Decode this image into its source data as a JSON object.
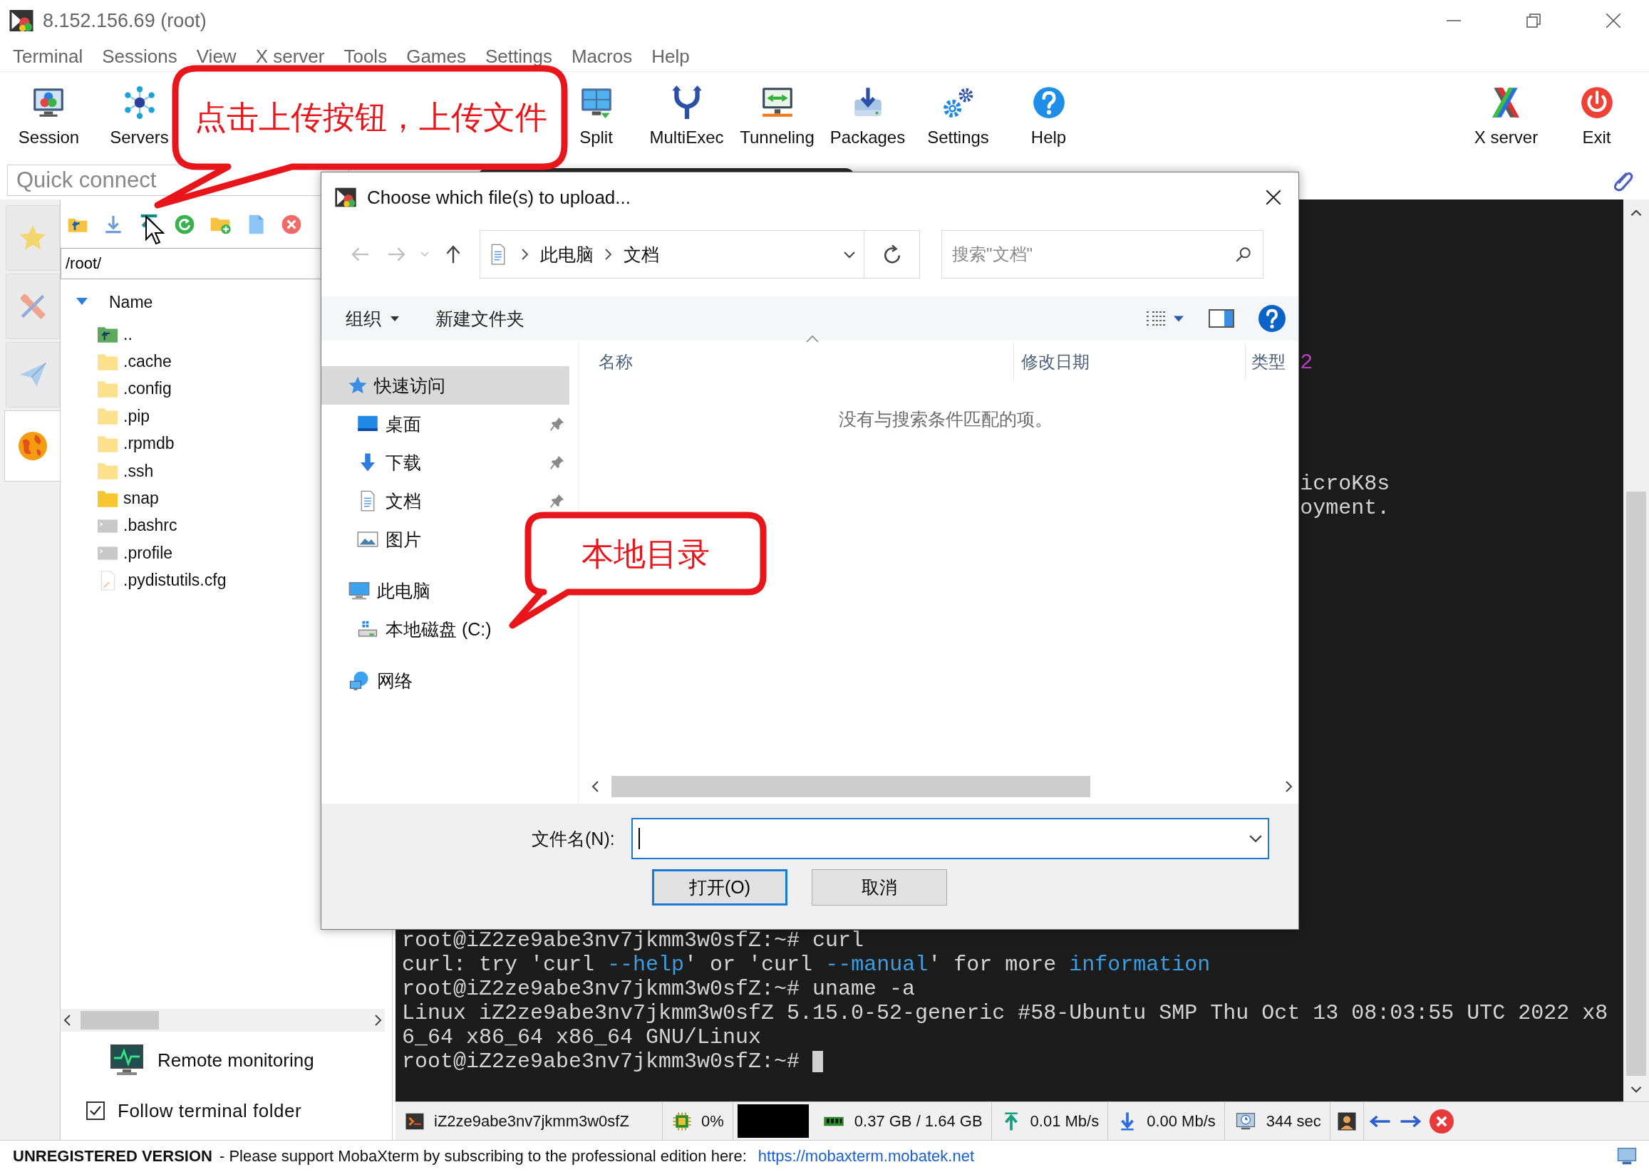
{
  "window": {
    "title": "8.152.156.69 (root)"
  },
  "menu": [
    "Terminal",
    "Sessions",
    "View",
    "X server",
    "Tools",
    "Games",
    "Settings",
    "Macros",
    "Help"
  ],
  "toolbar": {
    "buttons": [
      {
        "label": "Session",
        "kind": "session"
      },
      {
        "label": "Servers",
        "kind": "servers"
      },
      {
        "label": "Split",
        "kind": "split"
      },
      {
        "label": "MultiExec",
        "kind": "multiexec"
      },
      {
        "label": "Tunneling",
        "kind": "tunneling"
      },
      {
        "label": "Packages",
        "kind": "packages"
      },
      {
        "label": "Settings",
        "kind": "settings"
      },
      {
        "label": "Help",
        "kind": "help"
      }
    ],
    "right_buttons": [
      {
        "label": "X server",
        "kind": "xserver"
      },
      {
        "label": "Exit",
        "kind": "exit"
      }
    ]
  },
  "quick_connect": {
    "placeholder": "Quick connect"
  },
  "side_tabs": [
    {
      "kind": "star",
      "selected": false
    },
    {
      "kind": "tools",
      "selected": false
    },
    {
      "kind": "send",
      "selected": false
    },
    {
      "kind": "globe",
      "selected": true
    }
  ],
  "file_browser": {
    "tools": [
      {
        "kind": "up-folder"
      },
      {
        "kind": "download"
      },
      {
        "kind": "upload"
      },
      {
        "kind": "refresh"
      },
      {
        "kind": "new-folder"
      },
      {
        "kind": "new-file"
      },
      {
        "kind": "delete"
      }
    ],
    "path": "/root/",
    "column": "Name",
    "items": [
      {
        "name": "..",
        "kind": "parent",
        "hidden": false
      },
      {
        "name": ".cache",
        "kind": "folder",
        "hidden": true
      },
      {
        "name": ".config",
        "kind": "folder",
        "hidden": true
      },
      {
        "name": ".pip",
        "kind": "folder",
        "hidden": true
      },
      {
        "name": ".rpmdb",
        "kind": "folder",
        "hidden": true
      },
      {
        "name": ".ssh",
        "kind": "folder",
        "hidden": true
      },
      {
        "name": "snap",
        "kind": "folder",
        "hidden": false
      },
      {
        "name": ".bashrc",
        "kind": "terminal-file",
        "hidden": true
      },
      {
        "name": ".profile",
        "kind": "terminal-file",
        "hidden": true
      },
      {
        "name": ".pydistutils.cfg",
        "kind": "text-file",
        "hidden": true
      }
    ],
    "remote_monitoring": "Remote monitoring",
    "follow_terminal_folder": {
      "label": "Follow terminal folder",
      "checked": true
    }
  },
  "terminal": {
    "fragments": [
      {
        "text": "2",
        "color": "#c040c8"
      },
      {
        "text": "icroK8s",
        "color": "#d4d4d4"
      },
      {
        "text": "oyment.",
        "color": "#d4d4d4"
      }
    ],
    "lines": [
      {
        "cursor": false,
        "segments": [
          {
            "text": "root@iZ2ze9abe3nv7jkmm3w0sfZ:~# curl",
            "color": "#d4d4d4"
          }
        ]
      },
      {
        "cursor": false,
        "segments": [
          {
            "text": "curl: try 'curl ",
            "color": "#d4d4d4"
          },
          {
            "text": "--help",
            "color": "#3a9ee0"
          },
          {
            "text": "' or 'curl ",
            "color": "#d4d4d4"
          },
          {
            "text": "--manual",
            "color": "#3a9ee0"
          },
          {
            "text": "' for more ",
            "color": "#d4d4d4"
          },
          {
            "text": "information",
            "color": "#3a9ee0"
          }
        ]
      },
      {
        "cursor": false,
        "segments": [
          {
            "text": "root@iZ2ze9abe3nv7jkmm3w0sfZ:~# uname -a",
            "color": "#d4d4d4"
          }
        ]
      },
      {
        "cursor": false,
        "segments": [
          {
            "text": "Linux iZ2ze9abe3nv7jkmm3w0sfZ 5.15.0-52-generic #58-Ubuntu SMP Thu Oct 13 08:03:55 UTC 2022 x8",
            "color": "#d4d4d4"
          }
        ]
      },
      {
        "cursor": false,
        "segments": [
          {
            "text": "6_64 x86_64 x86_64 GNU/Linux",
            "color": "#d4d4d4"
          }
        ]
      },
      {
        "cursor": true,
        "segments": [
          {
            "text": "root@iZ2ze9abe3nv7jkmm3w0sfZ:~# ",
            "color": "#d4d4d4"
          }
        ]
      }
    ]
  },
  "status_bar": {
    "items": [
      {
        "kind": "session",
        "text": "iZ2ze9abe3nv7jkmm3w0sfZ"
      },
      {
        "kind": "cpu",
        "text": "0%"
      },
      {
        "kind": "graph"
      },
      {
        "kind": "memory",
        "text": "0.37 GB / 1.64 GB"
      },
      {
        "kind": "upload",
        "text": "0.01 Mb/s"
      },
      {
        "kind": "download",
        "text": "0.00 Mb/s"
      },
      {
        "kind": "uptime",
        "text": "344 sec"
      },
      {
        "kind": "user"
      },
      {
        "kind": "nav"
      },
      {
        "kind": "close"
      }
    ]
  },
  "notice": {
    "title": "UNREGISTERED VERSION",
    "message": "-  Please support MobaXterm by subscribing to the professional edition here:",
    "link": "https://mobaxterm.mobatek.net"
  },
  "dialog": {
    "title": "Choose which file(s) to upload...",
    "breadcrumb": [
      "此电脑",
      "文档"
    ],
    "search": {
      "placeholder": "搜索\"文档\""
    },
    "commands": [
      {
        "label": "组织",
        "kind": "menu"
      },
      {
        "label": "新建文件夹",
        "kind": "plain"
      }
    ],
    "nav": [
      {
        "label": "快速访问",
        "kind": "star",
        "selected": true,
        "children": [
          {
            "label": "桌面",
            "kind": "desktop",
            "selected": false,
            "pinned": true
          },
          {
            "label": "下载",
            "kind": "download",
            "selected": false,
            "pinned": true
          },
          {
            "label": "文档",
            "kind": "document",
            "selected": false,
            "pinned": true
          },
          {
            "label": "图片",
            "kind": "picture",
            "selected": false,
            "pinned": false
          }
        ]
      },
      {
        "label": "此电脑",
        "kind": "computer",
        "selected": false,
        "children": [
          {
            "label": "本地磁盘 (C:)",
            "kind": "drive",
            "selected": false,
            "pinned": false
          }
        ]
      },
      {
        "label": "网络",
        "kind": "network",
        "selected": false
      }
    ],
    "columns": [
      "名称",
      "修改日期",
      "类型"
    ],
    "empty_message": "没有与搜索条件匹配的项。",
    "filename_label": "文件名(N):",
    "buttons": [
      {
        "label": "打开(O)",
        "default": true
      },
      {
        "label": "取消",
        "default": false
      }
    ]
  },
  "callouts": [
    {
      "text": "点击上传按钮，上传文件"
    },
    {
      "text": "本地目录"
    }
  ]
}
